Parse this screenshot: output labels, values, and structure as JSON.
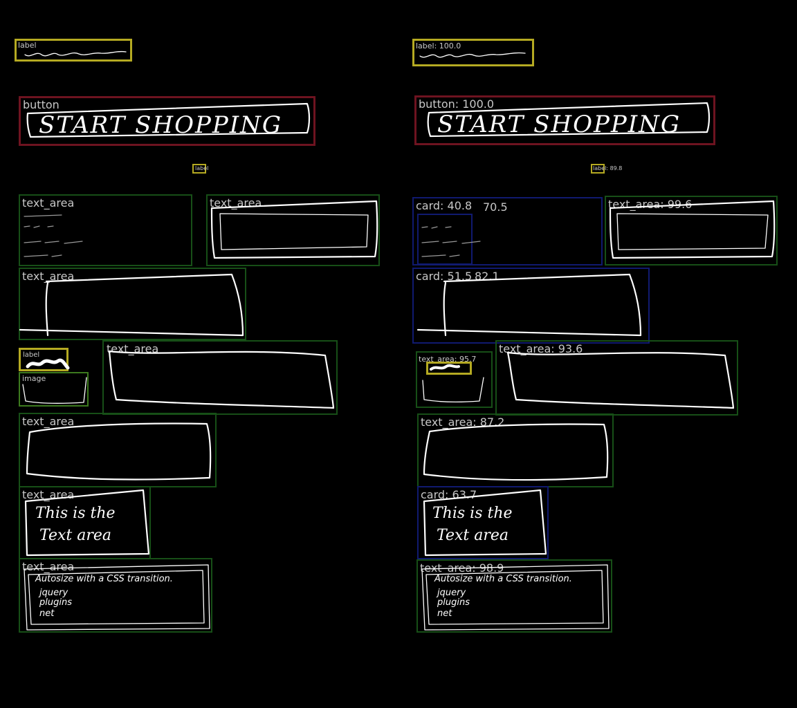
{
  "colors": {
    "background": "#000000",
    "label": "#b5aa22",
    "button": "#6e1320",
    "text_area": "#174f17",
    "image": "#3d7a1e",
    "card": "#101a70",
    "tag_text": "#c8c8c8",
    "sketch": "#ffffff"
  },
  "left": {
    "label_top": "label",
    "button": "button",
    "button_sketch": "START SHOPPING",
    "label_small": "label",
    "text_area_1": "text_area",
    "text_area_2": "text_area",
    "text_area_3": "text_area",
    "label_mid": "label",
    "image": "image",
    "text_area_4": "text_area",
    "text_area_5": "text_area",
    "text_area_6": "text_area",
    "text_area_6_sketch": [
      "This is the",
      "Text area"
    ],
    "text_area_7": "text_area",
    "text_area_7_sketch": [
      "Autosize with a CSS transition.",
      "jquery",
      "plugins",
      "net"
    ]
  },
  "right": {
    "label_top": "label: 100.0",
    "button": "button: 100.0",
    "button_sketch": "START SHOPPING",
    "label_small": "label: 89.8",
    "card_1": "card: 40.8",
    "card_1_inner": "70.5",
    "text_area_1": "text_area: 99.6",
    "card_2": "card: 51.5",
    "card_2_inner": "82.1",
    "text_area_small": "text_area: 95.7",
    "text_area_2": "text_area: 93.6",
    "text_area_3": "text_area: 87.2",
    "card_3": "card: 63.7",
    "card_3_sketch": [
      "This is the",
      "Text area"
    ],
    "text_area_4": "text_area: 98.9",
    "text_area_4_sketch": [
      "Autosize with a CSS transition.",
      "jquery",
      "plugins",
      "net"
    ]
  }
}
